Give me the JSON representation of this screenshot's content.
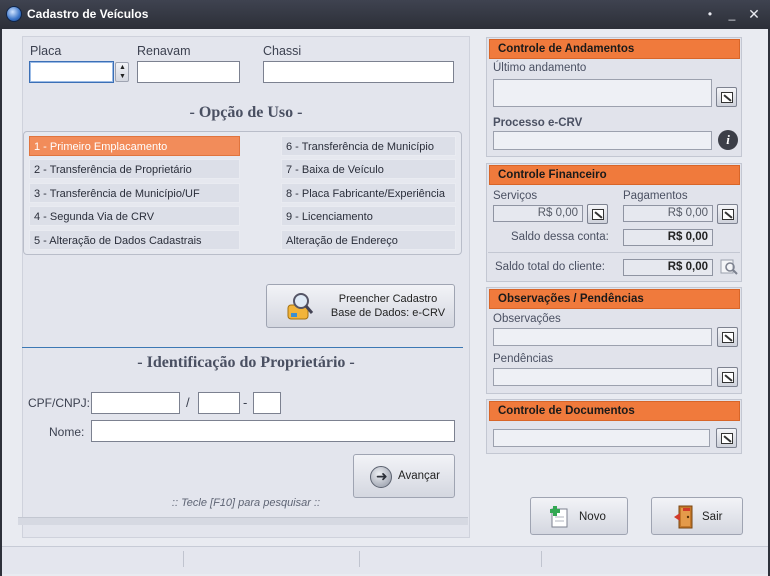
{
  "window": {
    "title": "Cadastro de Veículos"
  },
  "vehicle": {
    "placa_label": "Placa",
    "renavam_label": "Renavam",
    "chassi_label": "Chassi",
    "placa_value": "",
    "renavam_value": "",
    "chassi_value": ""
  },
  "uso": {
    "title": "- Opção de Uso -",
    "options_left": [
      "1 - Primeiro Emplacamento",
      "2 - Transferência de Proprietário",
      "3 - Transferência de Município/UF",
      "4 - Segunda Via de CRV",
      "5 - Alteração de Dados Cadastrais"
    ],
    "options_right": [
      "6 - Transferência de Município",
      "7 - Baixa de Veículo",
      "8 - Placa Fabricante/Experiência",
      "9 - Licenciamento",
      "Alteração de Endereço"
    ],
    "selected": "1 - Primeiro Emplacamento"
  },
  "preencher": {
    "line1": "Preencher Cadastro",
    "line2": "Base de Dados: e-CRV"
  },
  "proprietario": {
    "title": "- Identificação do Proprietário -",
    "cpf_label": "CPF/CNPJ:",
    "sep_slash": "/",
    "sep_dash": "-",
    "nome_label": "Nome:",
    "avancar": "Avançar",
    "hint": ":: Tecle [F10] para pesquisar ::"
  },
  "andamentos": {
    "header": "Controle de Andamentos",
    "ultimo_label": "Último andamento",
    "processo_label": "Processo e-CRV"
  },
  "financeiro": {
    "header": "Controle Financeiro",
    "servicos_label": "Serviços",
    "pagamentos_label": "Pagamentos",
    "servicos_value": "R$ 0,00",
    "pagamentos_value": "R$ 0,00",
    "saldo_conta_label": "Saldo dessa conta:",
    "saldo_conta_value": "R$ 0,00",
    "saldo_cliente_label": "Saldo total do cliente:",
    "saldo_cliente_value": "R$ 0,00"
  },
  "observacoes": {
    "header": "Observações / Pendências",
    "obs_label": "Observações",
    "pend_label": "Pendências"
  },
  "documentos": {
    "header": "Controle de Documentos"
  },
  "actions": {
    "novo": "Novo",
    "sair": "Sair"
  },
  "colors": {
    "accent": "#f07a3c",
    "selected_option": "#f28c5a",
    "title_bar": "#2c2f38"
  }
}
